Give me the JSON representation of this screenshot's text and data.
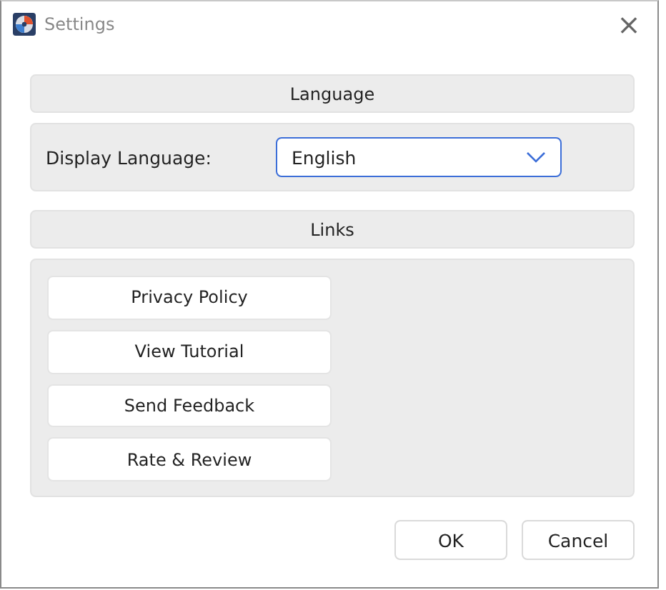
{
  "window": {
    "title": "Settings",
    "close": "×"
  },
  "language_section": {
    "heading": "Language",
    "label": "Display Language:",
    "dropdown": {
      "value": "English"
    }
  },
  "links_section": {
    "heading": "Links",
    "buttons": [
      "Privacy Policy",
      "View Tutorial",
      "Send Feedback",
      "Rate & Review"
    ]
  },
  "buttons": [
    "OK",
    "Cancel"
  ]
}
